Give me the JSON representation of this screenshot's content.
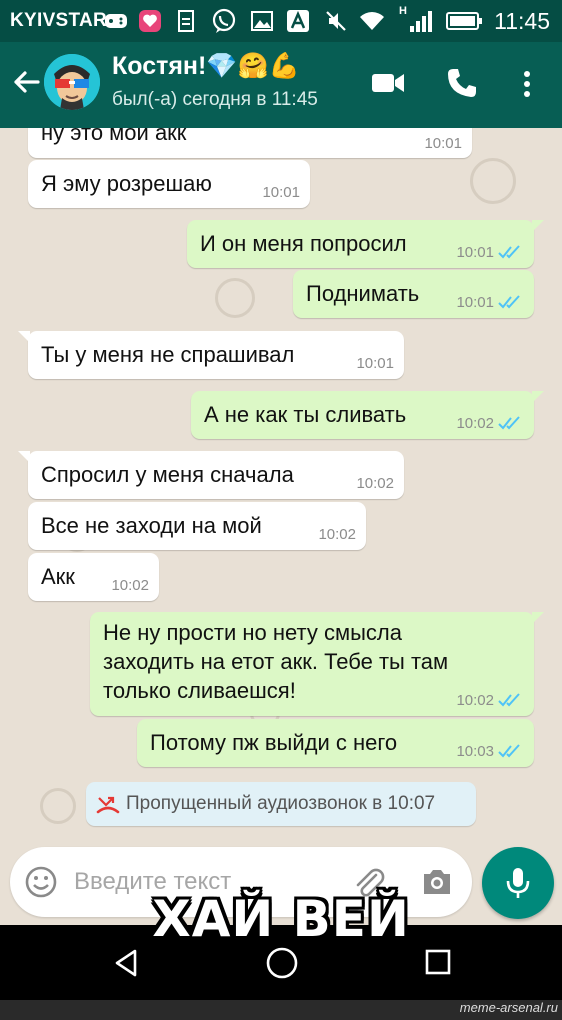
{
  "status_bar": {
    "carrier": "KYIVSTAR",
    "network_type": "H",
    "time": "11:45"
  },
  "header": {
    "contact_name": "Костян!💎🤗💪",
    "last_seen": "был(-а) сегодня в 11:45",
    "icons": [
      "back-arrow-icon",
      "video-call-icon",
      "phone-icon",
      "more-vert-icon"
    ]
  },
  "messages": [
    {
      "dir": "in",
      "text": "ну это мой акк",
      "time": "10:01"
    },
    {
      "dir": "in",
      "text": "Я эму розрешаю",
      "time": "10:01"
    },
    {
      "dir": "out",
      "text": "И он меня попросил",
      "time": "10:01",
      "read": true
    },
    {
      "dir": "out",
      "text": "Поднимать",
      "time": "10:01",
      "read": true
    },
    {
      "dir": "in",
      "text": "Ты у меня не спрашивал",
      "time": "10:01"
    },
    {
      "dir": "out",
      "text": "А не как ты сливать",
      "time": "10:02",
      "read": true
    },
    {
      "dir": "in",
      "text": "Спросил у меня сначала",
      "time": "10:02"
    },
    {
      "dir": "in",
      "text": "Все не заходи на мой",
      "time": "10:02"
    },
    {
      "dir": "in",
      "text": "Акк",
      "time": "10:02"
    },
    {
      "dir": "out",
      "lines": [
        "Не ну прости но нету смысла",
        "заходить на етот акк. Тебе ты там",
        "только сливаешся!"
      ],
      "time": "10:02",
      "read": true
    },
    {
      "dir": "out",
      "text": "Потому пж выйди с него",
      "time": "10:03",
      "read": true
    }
  ],
  "missed_call": {
    "text": "Пропущенный аудиозвонок в 10:07"
  },
  "composer": {
    "placeholder": "Введите текст"
  },
  "meme_caption": "ХАЙ ВЕЙ",
  "watermark": "meme-arsenal.ru",
  "colors": {
    "header": "#075e54",
    "status_bar": "#054d44",
    "outgoing_bubble": "#dcf8c6",
    "incoming_bubble": "#ffffff",
    "chat_background": "#e8e0d5",
    "mic_button": "#00897b",
    "read_ticks": "#4fc3f7"
  }
}
